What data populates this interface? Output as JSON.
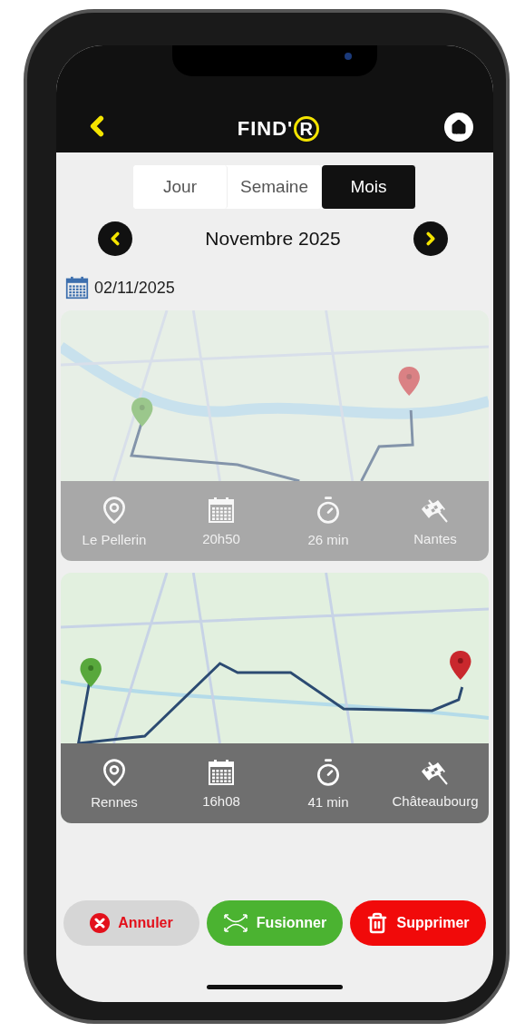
{
  "header": {
    "logo_text": "FIND'",
    "logo_mark": "R"
  },
  "tabs": [
    {
      "label": "Jour",
      "selected": false
    },
    {
      "label": "Semaine",
      "selected": false
    },
    {
      "label": "Mois",
      "selected": true
    }
  ],
  "period": "Novembre 2025",
  "date": "02/11/2025",
  "trips": [
    {
      "selected": false,
      "start": "Le Pellerin",
      "time": "20h50",
      "duration": "26 min",
      "end": "Nantes"
    },
    {
      "selected": true,
      "start": "Rennes",
      "time": "16h08",
      "duration": "41 min",
      "end": "Châteaubourg"
    }
  ],
  "actions": [
    {
      "kind": "cancel",
      "label": "Annuler"
    },
    {
      "kind": "merge",
      "label": "Fusionner"
    },
    {
      "kind": "delete",
      "label": "Supprimer"
    }
  ]
}
